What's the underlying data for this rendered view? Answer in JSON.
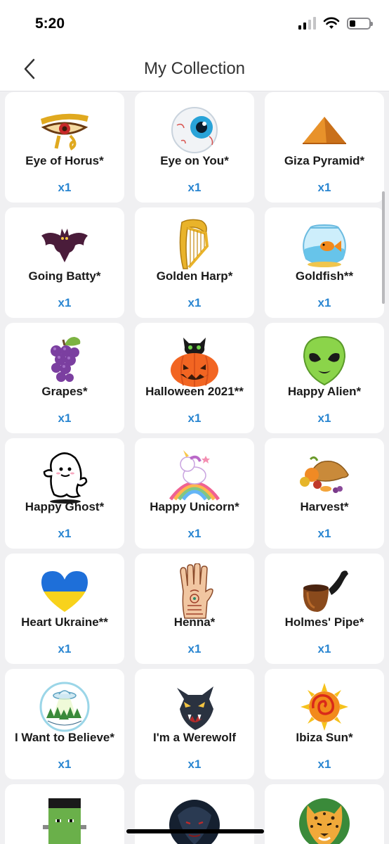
{
  "status": {
    "time": "5:20"
  },
  "nav": {
    "title": "My Collection"
  },
  "items": [
    {
      "name": "Eye of Horus*",
      "count": "x1",
      "icon": "eye-of-horus-icon"
    },
    {
      "name": "Eye on You*",
      "count": "x1",
      "icon": "eyeball-icon"
    },
    {
      "name": "Giza Pyramid*",
      "count": "x1",
      "icon": "pyramid-icon"
    },
    {
      "name": "Going Batty*",
      "count": "x1",
      "icon": "bat-icon"
    },
    {
      "name": "Golden Harp*",
      "count": "x1",
      "icon": "harp-icon"
    },
    {
      "name": "Goldfish**",
      "count": "x1",
      "icon": "goldfish-bowl-icon"
    },
    {
      "name": "Grapes*",
      "count": "x1",
      "icon": "grapes-icon"
    },
    {
      "name": "Halloween 2021**",
      "count": "x1",
      "icon": "pumpkin-cat-icon"
    },
    {
      "name": "Happy Alien*",
      "count": "x1",
      "icon": "alien-icon"
    },
    {
      "name": "Happy Ghost*",
      "count": "x1",
      "icon": "ghost-icon"
    },
    {
      "name": "Happy Unicorn*",
      "count": "x1",
      "icon": "unicorn-icon"
    },
    {
      "name": "Harvest*",
      "count": "x1",
      "icon": "cornucopia-icon"
    },
    {
      "name": "Heart Ukraine**",
      "count": "x1",
      "icon": "ukraine-heart-icon"
    },
    {
      "name": "Henna*",
      "count": "x1",
      "icon": "henna-hand-icon"
    },
    {
      "name": "Holmes' Pipe*",
      "count": "x1",
      "icon": "pipe-icon"
    },
    {
      "name": "I Want to Believe*",
      "count": "x1",
      "icon": "ufo-badge-icon"
    },
    {
      "name": "I'm a Werewolf",
      "count": "x1",
      "icon": "werewolf-icon"
    },
    {
      "name": "Ibiza Sun*",
      "count": "x1",
      "icon": "sun-icon"
    }
  ],
  "partial_items": [
    {
      "icon": "frankenstein-icon"
    },
    {
      "icon": "vampire-icon"
    },
    {
      "icon": "jaguar-icon"
    }
  ]
}
